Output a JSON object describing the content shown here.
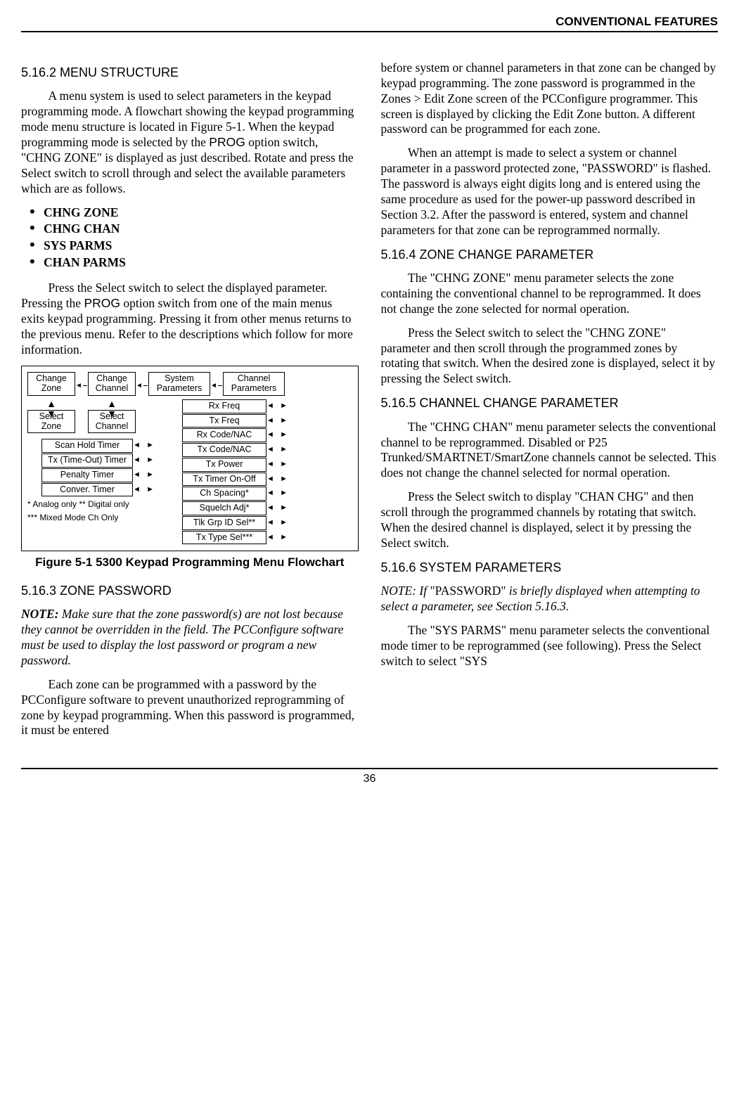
{
  "header": {
    "title": "CONVENTIONAL FEATURES"
  },
  "page_number": "36",
  "left": {
    "s5162": {
      "heading": "5.16.2  MENU STRUCTURE",
      "p1a": "A menu system is used to select parameters in the keypad programming mode. A flowchart showing the keypad programming mode menu structure is located in Figure 5-1. When the keypad programming mode is selected by the ",
      "prog1": "PROG",
      "p1b": " option switch, \"CHNG ZONE\" is displayed as just described. Rotate and press the Select switch to scroll through and select the available parameters which are as follows.",
      "bullets": [
        "CHNG ZONE",
        "CHNG CHAN",
        "SYS PARMS",
        "CHAN PARMS"
      ],
      "p2a": "Press the Select switch to select the displayed parameter. Pressing the ",
      "prog2": "PROG",
      "p2b": " option switch from one of the main menus exits keypad programming. Pressing it from other menus returns to the previous menu. Refer to the descriptions which follow for more information."
    },
    "figure": {
      "top": {
        "change_zone": "Change\nZone",
        "change_channel": "Change\nChannel",
        "system_params": "System\nParameters",
        "channel_params": "Channel\nParameters"
      },
      "selects": {
        "select_zone": "Select\nZone",
        "select_channel": "Select\nChannel"
      },
      "sys_params": [
        "Scan Hold Timer",
        "Tx (Time-Out) Timer",
        "Penalty Timer",
        "Conver. Timer"
      ],
      "chan_params": [
        "Rx Freq",
        "Tx Freq",
        "Rx Code/NAC",
        "Tx Code/NAC",
        "Tx Power",
        "Tx Timer On-Off",
        "Ch Spacing*",
        "Squelch Adj*",
        "Tlk Grp ID Sel**",
        "Tx Type Sel***"
      ],
      "notes_line1": "* Analog only      ** Digital only",
      "notes_line2": "*** Mixed Mode Ch Only",
      "caption": "Figure 5-1   5300 Keypad Programming Menu Flowchart"
    },
    "s5163": {
      "heading": "5.16.3  ZONE PASSWORD",
      "note_label": "NOTE:",
      "note_body": " Make sure that the zone password(s) are not lost because they cannot be overridden in the field. The PCConfigure software must be used to display the lost password or program a new password.",
      "p1": "Each zone can be programmed with a password by the PCConfigure software to prevent unauthorized reprogramming of zone by keypad programming. When this password is programmed, it must be entered"
    }
  },
  "right": {
    "cont1": "before system or channel parameters in that zone can be changed by keypad programming. The zone password is programmed in the Zones > Edit Zone screen of the PCConfigure programmer. This screen is displayed by clicking the Edit Zone button. A different password can be programmed for each zone.",
    "cont2": "When an attempt is made to select a system or channel parameter in a password protected zone, \"PASSWORD\" is flashed. The password is always eight digits long and is entered using the same procedure as used for the power-up password described in Section 3.2. After the password is entered, system and channel parameters for that zone can be reprogrammed normally.",
    "s5164": {
      "heading": "5.16.4  ZONE CHANGE PARAMETER",
      "p1": "The \"CHNG ZONE\" menu parameter selects the zone containing the conventional channel to be reprogrammed. It does not change the zone selected for normal operation.",
      "p2": "Press the Select switch to select the \"CHNG ZONE\" parameter and then scroll through the programmed zones by rotating that switch. When the desired zone is displayed, select it by pressing the Select switch."
    },
    "s5165": {
      "heading": "5.16.5  CHANNEL CHANGE PARAMETER",
      "p1": "The \"CHNG CHAN\" menu parameter selects the conventional channel to be reprogrammed. Disabled or P25 Trunked/SMARTNET/SmartZone channels cannot be selected. This does not change the channel selected for normal operation.",
      "p2": "Press the Select switch to display \"CHAN CHG\" and then scroll through the programmed channels by rotating that switch. When the desired channel is displayed, select it by pressing the Select switch."
    },
    "s5166": {
      "heading": "5.16.6  SYSTEM PARAMETERS",
      "note_label": "NOTE: If ",
      "note_quote": "\"PASSWORD\"",
      "note_body": " is briefly displayed when attempting to select a parameter, see Section 5.16.3.",
      "p1": "The \"SYS PARMS\" menu parameter selects the conventional mode timer to be reprogrammed (see following). Press the Select switch to select \"SYS"
    }
  }
}
